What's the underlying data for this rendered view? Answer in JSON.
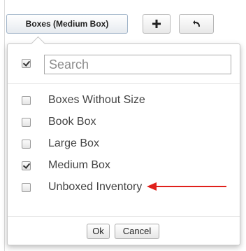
{
  "toolbar": {
    "filter_button_label": "Boxes (Medium Box)",
    "add_icon": "plus-icon",
    "undo_icon": "undo-icon"
  },
  "popup": {
    "search": {
      "placeholder": "Search",
      "value": "",
      "select_all_checked": true
    },
    "options": [
      {
        "label": "Boxes Without Size",
        "checked": false
      },
      {
        "label": "Book Box",
        "checked": false
      },
      {
        "label": "Large Box",
        "checked": false
      },
      {
        "label": "Medium Box",
        "checked": true
      },
      {
        "label": "Unboxed Inventory",
        "checked": false
      }
    ],
    "ok_label": "Ok",
    "cancel_label": "Cancel"
  },
  "annotation": {
    "arrow_color": "#e0201b",
    "arrow_icon": "red-arrow-left-icon"
  },
  "colors": {
    "border": "#c9c9c9",
    "text": "#444444"
  }
}
